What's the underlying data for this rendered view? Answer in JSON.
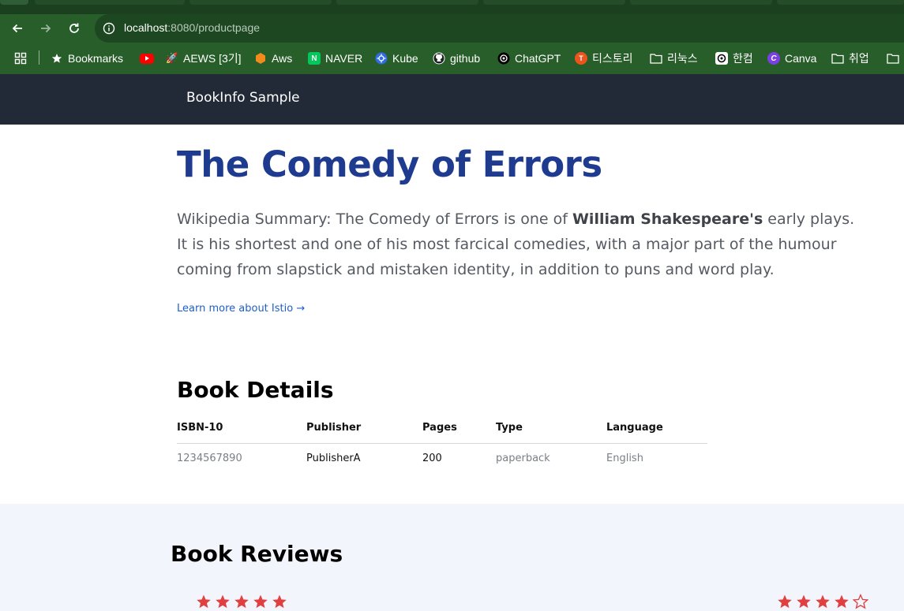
{
  "browser": {
    "url_host": "localhost",
    "url_path": ":8080/productpage",
    "bookmarks": [
      {
        "label": "Bookmarks",
        "icon": "star-icon"
      },
      {
        "label": "",
        "icon": "youtube-icon"
      },
      {
        "label": "AEWS [3기]",
        "icon": "rocket-icon"
      },
      {
        "label": "Aws",
        "icon": "aws-icon"
      },
      {
        "label": "NAVER",
        "icon": "naver-icon"
      },
      {
        "label": "Kube",
        "icon": "kubernetes-icon"
      },
      {
        "label": "github",
        "icon": "github-icon"
      },
      {
        "label": "ChatGPT",
        "icon": "chatgpt-icon"
      },
      {
        "label": "티스토리",
        "icon": "tistory-icon"
      },
      {
        "label": "리눅스",
        "icon": "folder-icon"
      },
      {
        "label": "한컴",
        "icon": "hancom-icon"
      },
      {
        "label": "Canva",
        "icon": "canva-icon"
      },
      {
        "label": "취업",
        "icon": "folder-icon"
      }
    ]
  },
  "navbar": {
    "brand": "BookInfo Sample"
  },
  "book": {
    "title": "The Comedy of Errors",
    "summary_prefix": "Wikipedia Summary: The Comedy of Errors is one of ",
    "summary_bold": "William Shakespeare's",
    "summary_suffix": " early plays. It is his shortest and one of his most farcical comedies, with a major part of the humour coming from slapstick and mistaken identity, in addition to puns and word play.",
    "learn_more": "Learn more about Istio →"
  },
  "details": {
    "heading": "Book Details",
    "columns": [
      "ISBN-10",
      "Publisher",
      "Pages",
      "Type",
      "Language"
    ],
    "row": [
      "1234567890",
      "PublisherA",
      "200",
      "paperback",
      "English"
    ]
  },
  "reviews": {
    "heading": "Book Reviews",
    "ratings": [
      5,
      4
    ],
    "max_stars": 5,
    "star_color": "#e04040"
  },
  "colors": {
    "title": "#1f3b8f",
    "navbar": "#222a37",
    "link": "#1f5fc8",
    "browser_toolbar": "#275e2a"
  }
}
